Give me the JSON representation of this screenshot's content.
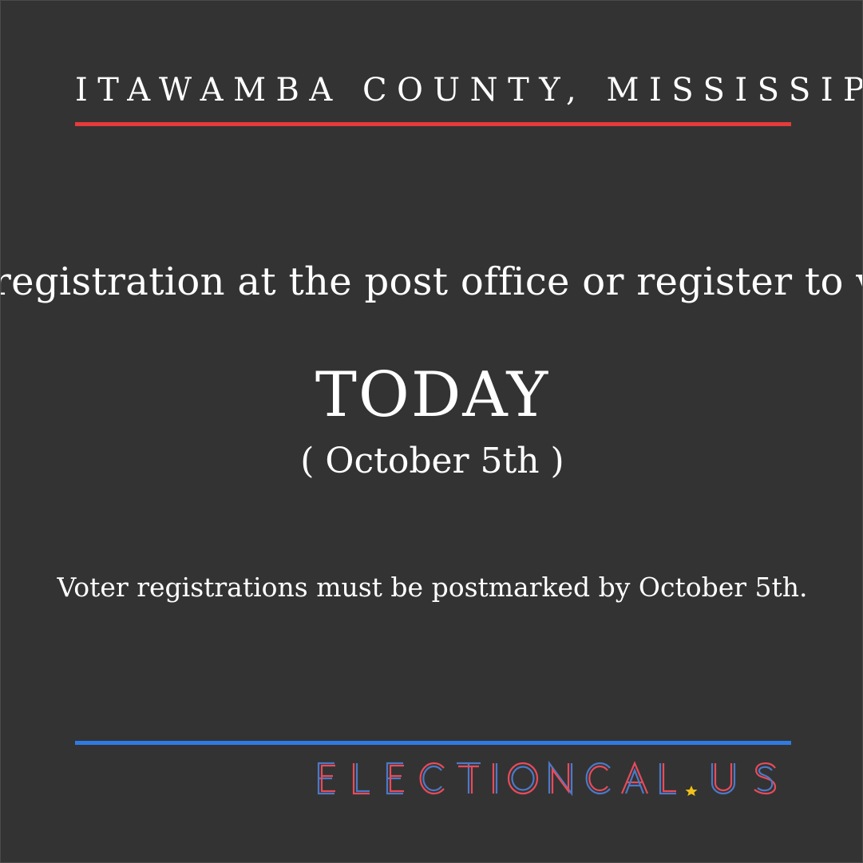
{
  "header": {
    "county": "ITAWAMBA COUNTY, MISSISSIPPI"
  },
  "main": {
    "headline": "Mail in voter registration at the post office or register to vote in person",
    "emphasis": "TODAY",
    "date": "( October 5th )",
    "note": "Voter registrations must be postmarked by October 5th."
  },
  "footer": {
    "brand": "ELECTIONCAL.US"
  },
  "colors": {
    "background": "#333333",
    "red_accent": "#e63b3b",
    "blue_accent": "#2f7be6",
    "star": "#f2c21a"
  }
}
